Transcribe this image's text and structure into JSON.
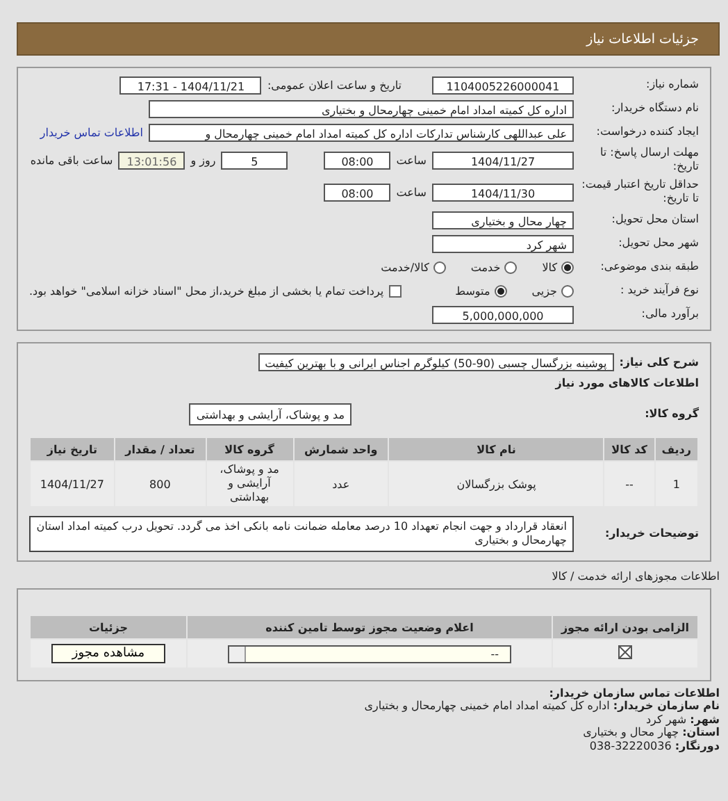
{
  "header": {
    "title": "جزئیات اطلاعات نیاز"
  },
  "details": {
    "need_number": {
      "label": "شماره نیاز:",
      "value": "1104005226000041"
    },
    "announce": {
      "label": "تاریخ و ساعت اعلان عمومی:",
      "value": "1404/11/21 - 17:31"
    },
    "buyer": {
      "label": "نام دستگاه خریدار:",
      "value": "اداره کل کمیته امداد امام خمینی چهارمحال و بختیاری"
    },
    "creator": {
      "label": "ایجاد کننده درخواست:",
      "value": "علی عبداللهی کارشناس تدارکات اداره کل کمیته امداد امام خمینی چهارمحال و",
      "link": "اطلاعات تماس خریدار"
    },
    "deadline": {
      "label": "مهلت ارسال پاسخ: تا تاریخ:",
      "date": "1404/11/27",
      "time_label": "ساعت",
      "time": "08:00",
      "days": "5",
      "days_label": "روز و",
      "remaining": "13:01:56",
      "remaining_label": "ساعت باقی مانده"
    },
    "validity": {
      "label": "حداقل تاریخ اعتبار قیمت: تا تاریخ:",
      "date": "1404/11/30",
      "time_label": "ساعت",
      "time": "08:00"
    },
    "province": {
      "label": "استان محل تحویل:",
      "value": "چهار محال و بختیاری"
    },
    "city": {
      "label": "شهر محل تحویل:",
      "value": "شهر کرد"
    },
    "category": {
      "label": "طبقه بندی موضوعی:",
      "options": [
        {
          "label": "کالا",
          "selected": true
        },
        {
          "label": "خدمت",
          "selected": false
        },
        {
          "label": "کالا/خدمت",
          "selected": false
        }
      ]
    },
    "process": {
      "label": "نوع فرآیند خرید :",
      "options": [
        {
          "label": "جزیی",
          "selected": false
        },
        {
          "label": "متوسط",
          "selected": true
        }
      ],
      "treasury": {
        "label": "پرداخت تمام یا بخشی از مبلغ خرید،از محل \"اسناد خزانه اسلامی\" خواهد بود.",
        "checked": false
      }
    },
    "budget": {
      "label": "برآورد مالی:",
      "value": "5,000,000,000"
    }
  },
  "goods": {
    "description": {
      "label": "شرح کلی نیاز:",
      "value": "پوشینه بزرگسال چسبی (90-50) کیلوگرم اجناس ایرانی و با بهترین کیفیت"
    },
    "heading": "اطلاعات کالاهای مورد نیاز",
    "group": {
      "label": "گروه کالا:",
      "value": "مد و پوشاک، آرایشی و بهداشتی"
    },
    "table": {
      "columns": [
        "ردیف",
        "کد کالا",
        "نام کالا",
        "واحد شمارش",
        "گروه کالا",
        "تعداد / مقدار",
        "تاریخ نیاز"
      ],
      "rows": [
        [
          "1",
          "--",
          "پوشک بزرگسالان",
          "عدد",
          "مد و پوشاک، آرایشی و بهداشتی",
          "800",
          "1404/11/27"
        ]
      ]
    },
    "notes": {
      "label": "توضیحات خریدار:",
      "value": "انعقاد قرارداد و جهت انجام تعهداد 10 درصد معامله ضمانت نامه بانکی اخذ می گردد. تحویل درب کمیته امداد استان چهارمحال و بختیاری"
    }
  },
  "licenses": {
    "title": "اطلاعات مجوزهای ارائه خدمت / کالا",
    "columns": [
      "الزامی بودن ارائه مجوز",
      "اعلام وضعیت مجوز توسط تامین کننده",
      "جزئیات"
    ],
    "rows": [
      {
        "required": true,
        "status": "--",
        "action": "مشاهده مجوز"
      }
    ]
  },
  "contact": {
    "title": "اطلاعات تماس سازمان خریدار:",
    "lines": [
      {
        "label": "نام سازمان خریدار:",
        "value": "اداره کل کمیته امداد امام خمینی چهارمحال و بختیاری"
      },
      {
        "label": "شهر:",
        "value": "شهر کرد"
      },
      {
        "label": "استان:",
        "value": "چهار محال و بختیاری"
      },
      {
        "label": "دورنگار:",
        "value": "038-32220036"
      }
    ]
  }
}
